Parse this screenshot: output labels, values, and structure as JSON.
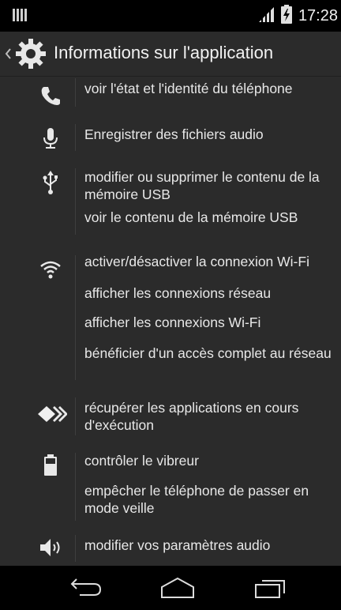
{
  "status_bar": {
    "time": "17:28",
    "icons": [
      "notification-icon",
      "signal-icon",
      "battery-charging-icon"
    ]
  },
  "action_bar": {
    "title": "Informations sur l'application",
    "icons": [
      "back-caret-icon",
      "settings-gear-icon"
    ]
  },
  "permission_groups": [
    {
      "icon": "phone-icon",
      "permissions": [
        "voir l'état et l'identité du téléphone"
      ]
    },
    {
      "icon": "microphone-icon",
      "permissions": [
        "Enregistrer des fichiers audio"
      ]
    },
    {
      "icon": "usb-icon",
      "permissions": [
        "modifier ou supprimer le contenu de la mémoire USB",
        "voir le contenu de la mémoire USB"
      ]
    },
    {
      "icon": "wifi-icon",
      "permissions": [
        "activer/désactiver la connexion Wi-Fi",
        "afficher les connexions réseau",
        "afficher les connexions Wi-Fi",
        "bénéficier d'un accès complet au réseau"
      ]
    },
    {
      "icon": "running-apps-icon",
      "permissions": [
        "récupérer les applications en cours d'exécution"
      ]
    },
    {
      "icon": "battery-icon",
      "permissions": [
        "contrôler le vibreur",
        "empêcher le téléphone de passer en mode veille"
      ]
    },
    {
      "icon": "speaker-icon",
      "permissions": [
        "modifier vos paramètres audio"
      ]
    }
  ],
  "nav_bar": {
    "buttons": [
      "back-icon",
      "home-icon",
      "recents-icon"
    ]
  },
  "colors": {
    "background": "#2b2b2b",
    "status_bar": "#000000",
    "text": "#e8e8e8",
    "divider": "#3e3e3e"
  }
}
